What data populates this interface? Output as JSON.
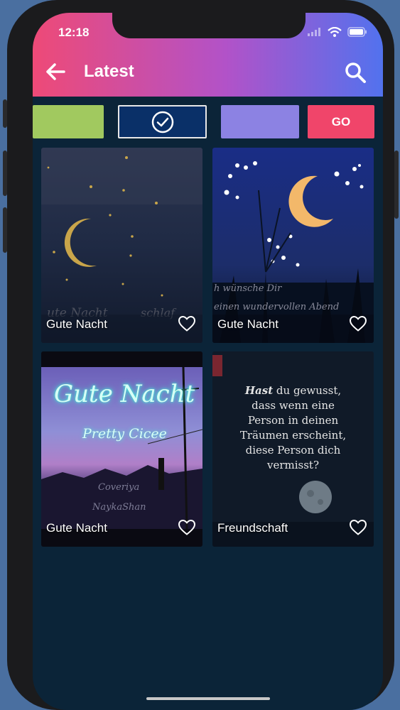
{
  "status_bar": {
    "time": "12:18"
  },
  "header": {
    "title": "Latest"
  },
  "color_bar": {
    "swatches": [
      {
        "name": "green",
        "color": "#a1c95f"
      },
      {
        "name": "navy",
        "color": "#0a3068",
        "selected": true
      },
      {
        "name": "lavender",
        "color": "#8c82e3"
      }
    ],
    "go_label": "GO",
    "go_color": "#f0456a"
  },
  "cards": [
    {
      "label": "Gute Nacht"
    },
    {
      "label": "Gute Nacht"
    },
    {
      "label": "Gute Nacht",
      "art_title": "Gute Nacht",
      "art_subtitle": "Pretty Cicee",
      "art_credit_1": "Coveriya",
      "art_credit_2": "NaykaShan"
    },
    {
      "label": "Freundschaft",
      "quote_lead": "Hast",
      "quote_line_1": "du gewusst,",
      "quote_line_2": "dass wenn eine",
      "quote_line_3": "Person in deinen",
      "quote_line_4": "Träumen erscheint,",
      "quote_line_5": "diese Person dich",
      "quote_line_6": "vermisst?"
    }
  ]
}
